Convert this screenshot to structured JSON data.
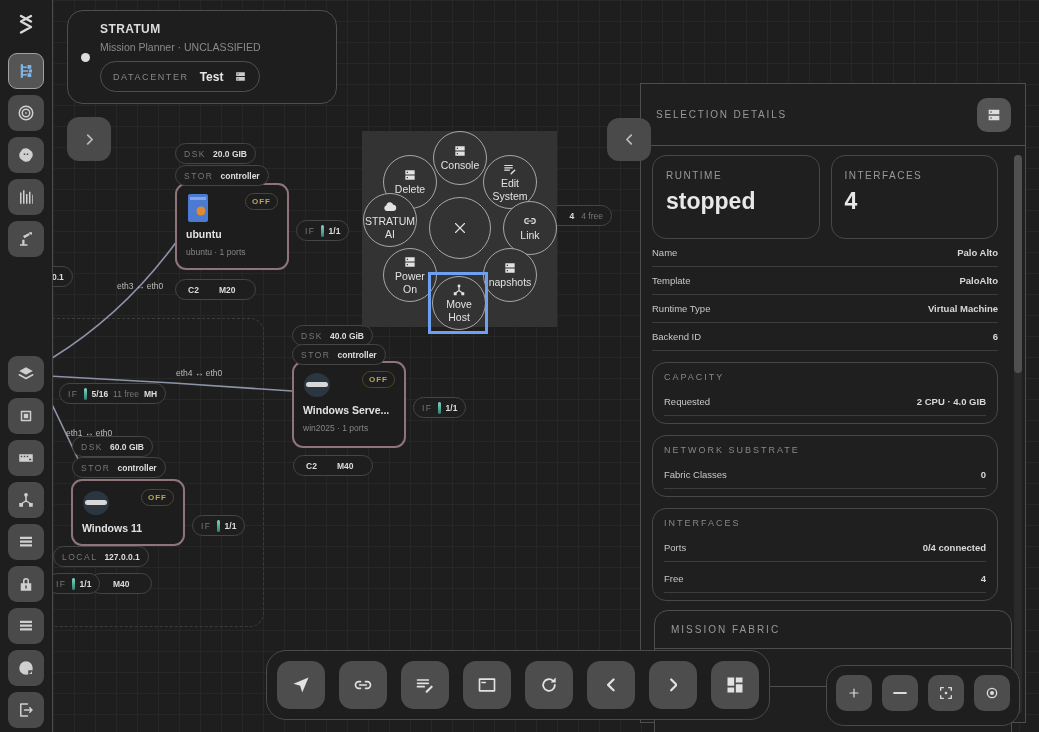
{
  "sidebar": {
    "groups": [
      [
        {
          "selected": true
        },
        {
          "selected": false
        },
        {
          "selected": false
        },
        {
          "selected": false
        },
        {
          "selected": false
        }
      ],
      [
        {
          "selected": false
        },
        {
          "selected": false
        },
        {
          "selected": false
        },
        {
          "selected": false
        },
        {
          "selected": false
        },
        {
          "selected": false
        },
        {
          "selected": false
        },
        {
          "selected": false
        },
        {
          "selected": false
        }
      ]
    ]
  },
  "mission": {
    "title": "STRATUM",
    "subtitle": "Mission Planner · UNCLASSIFIED",
    "datacenter_label": "DATACENTER",
    "datacenter": "Test"
  },
  "canvas": {
    "nodes": [
      {
        "kind": "linux",
        "name": "ubuntu",
        "subtitle": "ubuntu · 1 ports",
        "status": "OFF"
      },
      {
        "kind": "windows",
        "name": "Windows Serve...",
        "subtitle": "win2025 · 1 ports",
        "status": "OFF"
      },
      {
        "kind": "windows",
        "name": "Windows 11",
        "status": "OFF"
      }
    ],
    "chips": [
      {
        "kind": "pair",
        "label": "DSK",
        "value": "20.0 GIB"
      },
      {
        "kind": "pair",
        "label": "STOR",
        "value": "controller"
      },
      {
        "kind": "port",
        "label": "IF",
        "value": "1/1"
      },
      {
        "kind": "spec",
        "label": "C2",
        "value": "M20"
      },
      {
        "kind": "pair",
        "value": "0.1"
      },
      {
        "kind": "port",
        "label": "IF",
        "value": "5/16",
        "extra": "11 free",
        "tail": "MH"
      },
      {
        "kind": "pair",
        "label": "DSK",
        "value": "40.0 GiB"
      },
      {
        "kind": "pair",
        "label": "STOR",
        "value": "controller"
      },
      {
        "kind": "port",
        "label": "IF",
        "value": "1/1"
      },
      {
        "kind": "spec",
        "label": "C2",
        "value": "M40"
      },
      {
        "kind": "pair",
        "label": "DSK",
        "value": "60.0 GIB"
      },
      {
        "kind": "pair",
        "label": "STOR",
        "value": "controller"
      },
      {
        "kind": "port",
        "label": "IF",
        "value": "1/1"
      },
      {
        "kind": "pair",
        "label": "LOCAL",
        "value": "127.0.0.1"
      },
      {
        "kind": "spec",
        "value": "M40"
      },
      {
        "kind": "port",
        "label": "IF",
        "value": "1/1"
      },
      {
        "kind": "pair",
        "value": "4",
        "extra": "4 free"
      }
    ],
    "edge_labels": [
      "eth3 ↔ eth0",
      "eth4 ↔ eth0",
      "eth1 ↔ eth0"
    ]
  },
  "radial_menu": {
    "items": [
      {
        "label": "Delete",
        "selected": false
      },
      {
        "label": "Console",
        "selected": false
      },
      {
        "label": "Edit System",
        "selected": false
      },
      {
        "label": "Link",
        "selected": false
      },
      {
        "label": "STRATUM AI",
        "selected": false
      },
      {
        "label": "napshots",
        "selected": false
      },
      {
        "label": "Power On",
        "selected": false
      },
      {
        "label": "Move Host",
        "selected": true
      }
    ]
  },
  "details": {
    "title": "SELECTION DETAILS",
    "stats": [
      {
        "label": "RUNTIME",
        "value": "stopped"
      },
      {
        "label": "INTERFACES",
        "value": "4"
      }
    ],
    "rows": [
      {
        "label": "Name",
        "value": "Palo Alto"
      },
      {
        "label": "Template",
        "value": "PaloAlto"
      },
      {
        "label": "Runtime Type",
        "value": "Virtual Machine"
      },
      {
        "label": "Backend ID",
        "value": "6"
      }
    ],
    "sections": [
      {
        "title": "CAPACITY",
        "rows": [
          {
            "label": "Requested",
            "value": "2 CPU · 4.0 GIB"
          }
        ]
      },
      {
        "title": "NETWORK SUBSTRATE",
        "rows": [
          {
            "label": "Fabric Classes",
            "value": "0"
          }
        ]
      },
      {
        "title": "INTERFACES",
        "rows": [
          {
            "label": "Ports",
            "value": "0/4 connected"
          },
          {
            "label": "Free",
            "value": "4"
          }
        ]
      }
    ]
  },
  "mission_fabric": {
    "title": "MISSION FABRIC"
  }
}
